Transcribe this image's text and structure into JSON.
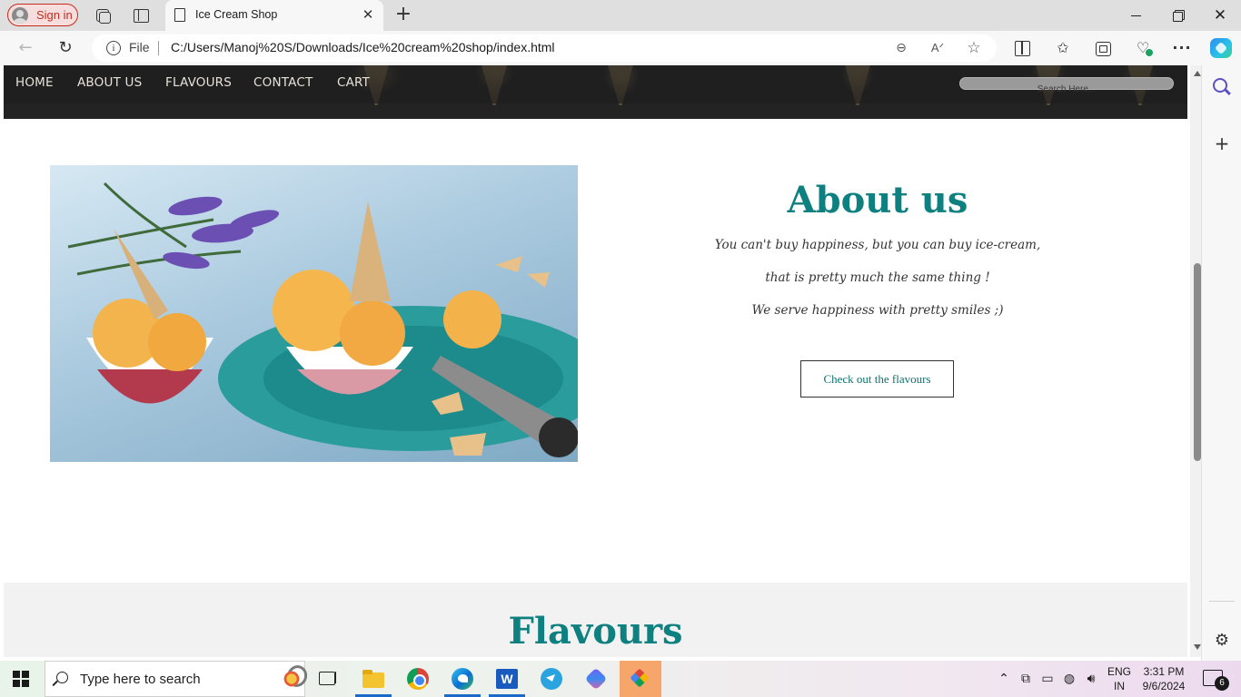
{
  "browser": {
    "sign_in_label": "Sign in",
    "tab_title": "Ice Cream Shop",
    "address_scheme": "File",
    "address_url": "C:/Users/Manoj%20S/Downloads/Ice%20cream%20shop/index.html"
  },
  "site": {
    "nav": [
      "HOME",
      "ABOUT US",
      "FLAVOURS",
      "CONTACT",
      "CART"
    ],
    "search_placeholder": "Search Here..."
  },
  "about": {
    "title": "About us",
    "lines": [
      "You can't buy happiness, but you can buy ice-cream,",
      "that is pretty much the same thing !",
      "We serve happiness with pretty smiles ;)"
    ],
    "cta_label": "Check out the flavours"
  },
  "flavours": {
    "title": "Flavours"
  },
  "taskbar": {
    "search_placeholder": "Type here to search",
    "lang_line1": "ENG",
    "lang_line2": "IN",
    "time": "3:31 PM",
    "date": "9/6/2024",
    "notification_count": "6",
    "accent_color": "#1b6ac9"
  },
  "colors": {
    "heading_teal": "#0f8080",
    "sign_in_red": "#c42b1c"
  }
}
